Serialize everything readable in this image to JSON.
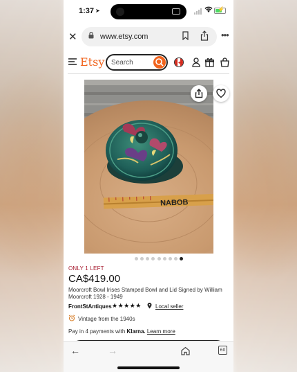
{
  "status_bar": {
    "time": "1:37",
    "location_icon": "location-arrow-icon",
    "wifi_icon": "wifi-icon",
    "battery_icon": "battery-charging-icon"
  },
  "browser": {
    "url": "www.etsy.com",
    "icons": [
      "close-icon",
      "lock-icon",
      "bookmark-icon",
      "share-icon",
      "more-icon"
    ]
  },
  "header": {
    "logo": "Etsy",
    "search_placeholder": "Search",
    "icons": [
      "menu-icon",
      "search-icon",
      "canada-flag-icon",
      "user-icon",
      "gift-icon",
      "bag-icon"
    ]
  },
  "product": {
    "image_icons": [
      "share-icon",
      "heart-icon"
    ],
    "image_count": 9,
    "active_image": 9,
    "stock_badge": "ONLY 1 LEFT",
    "price": "CA$419.00",
    "title": "Moorcroft Bowl Irises Stamped Bowl and Lid Signed by William Moorcroft 1928 - 1949",
    "seller": "FrontStAntiques",
    "rating_stars": "★★★★★",
    "rating": 5,
    "local_label": "Local seller",
    "vintage": "Vintage from the 1940s",
    "pay_prefix": "Pay in 4 payments with",
    "pay_brand": "Klarna.",
    "learn_more": "Learn more"
  },
  "bottom_bar": {
    "tabs_count": "60",
    "icons": [
      "back-arrow-icon",
      "forward-arrow-icon",
      "home-icon",
      "tabs-icon"
    ]
  },
  "colors": {
    "brand": "#f1641e",
    "stock": "#a61a2e"
  }
}
